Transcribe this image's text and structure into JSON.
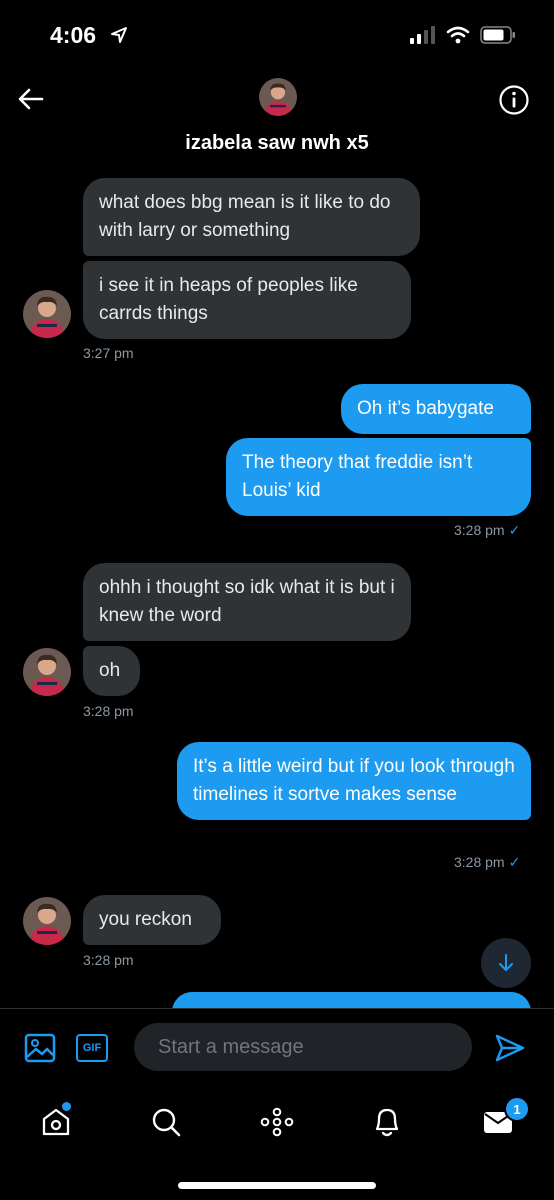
{
  "status": {
    "time": "4:06"
  },
  "header": {
    "title": "izabela saw nwh x5"
  },
  "messages": {
    "m1": "what does bbg mean is it like to do with larry or something",
    "m2": "i see it in heaps of peoples like carrds things",
    "ts1": "3:27 pm",
    "m3": "Oh it’s babygate",
    "m4": "The theory that freddie isn’t Louis’ kid",
    "ts2": "3:28 pm",
    "m5": "ohhh i thought so idk what it is but i knew the word",
    "m6": "oh",
    "ts3": "3:28 pm",
    "m7": "It’s a little weird but if you look through timelines it sortve makes sense",
    "ts4": "3:28 pm",
    "m8": "you reckon",
    "ts5": "3:28 pm",
    "check": "✓"
  },
  "composer": {
    "placeholder": "Start a message",
    "gif_label": "GIF"
  },
  "tabbar": {
    "messages_badge": "1"
  },
  "colors": {
    "accent": "#1d9bf0",
    "received_bubble": "#2f3336",
    "background": "#000000"
  }
}
